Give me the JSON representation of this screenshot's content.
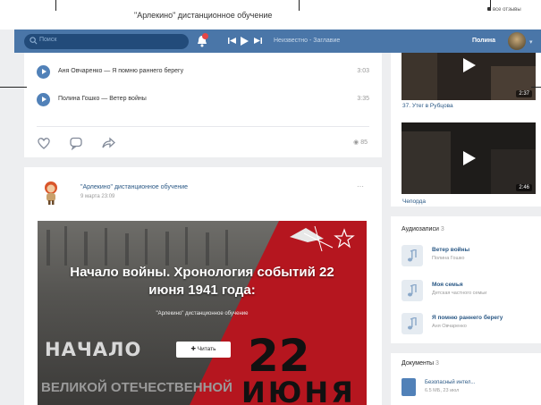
{
  "top_strip": {
    "title": "\"Арлекино\" дистанционное обучение",
    "right_text": "все отзывы"
  },
  "header": {
    "search_placeholder": "Поиск",
    "now_playing": "Неизвестно - Заглавие",
    "user_name": "Полина"
  },
  "post1": {
    "tracks": [
      {
        "title": "Аня Овчаренко — Я помню раннего берегу",
        "duration": "3:03"
      },
      {
        "title": "Полина Гошко — Ветер войны",
        "duration": "3:35"
      }
    ],
    "views": "85"
  },
  "post2": {
    "author": "\"Арлекино\" дистанционное обучение",
    "date": "9 марта 23:09",
    "banner": {
      "title_line1": "Начало войны. Хронология событий 22",
      "title_line2": "июня 1941 года:",
      "subtitle": "\"Арлекино\" дистанционное обучение",
      "read_button": "Читать",
      "big_left": "НАЧАЛО",
      "big_left2": "ВЕЛИКОЙ ОТЕЧЕСТВЕННОЙ",
      "big_number": "22",
      "big_month": "ИЮНЯ"
    }
  },
  "sidebar": {
    "video1_duration": "2:37",
    "video1_label": "37. Утег в Рубцова",
    "video2_duration": "2:46",
    "video2_label": "Чепорда",
    "audio_header": "Аудиозаписи",
    "audio_count": "3",
    "audios": [
      {
        "title": "Ветер войны",
        "artist": "Полина Гошко"
      },
      {
        "title": "Моя семья",
        "artist": "Детская частного семьи"
      },
      {
        "title": "Я помню раннего берегу",
        "artist": "Аня Овчаренко"
      }
    ],
    "docs_header": "Документы",
    "docs_count": "3",
    "doc_name": "Безопасный интел...",
    "doc_meta": "6.5 МБ, 23 июл"
  },
  "colors": {
    "header": "#4a76a8",
    "accent": "#5181b8",
    "banner_red": "#b5161f",
    "link": "#2a5885"
  }
}
